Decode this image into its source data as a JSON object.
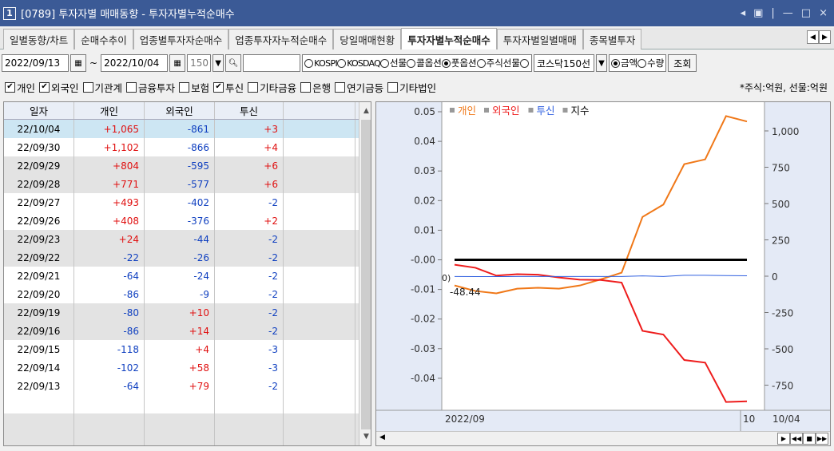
{
  "window": {
    "number": "1",
    "title": "[0789] 투자자별 매매동향 - 투자자별누적순매수",
    "controls": [
      "◂",
      "▣",
      "|",
      "—",
      "□",
      "×"
    ]
  },
  "tabs": [
    {
      "label": "일별동향/차트",
      "active": false
    },
    {
      "label": "순매수추이",
      "active": false
    },
    {
      "label": "업종별투자자순매수",
      "active": false
    },
    {
      "label": "업종투자자누적순매수",
      "active": false
    },
    {
      "label": "당일매매현황",
      "active": false
    },
    {
      "label": "투자자별누적순매수",
      "active": true
    },
    {
      "label": "투자자별일별매매",
      "active": false
    },
    {
      "label": "종목별투자",
      "active": false
    }
  ],
  "toolbar": {
    "start_date": "2022/09/13",
    "sep": "~",
    "end_date": "2022/10/04",
    "count": "150",
    "markets": [
      "KOSPI",
      "KOSDAQ",
      "선물",
      "콜옵션",
      "풋옵션",
      "주식선물",
      "코스닥150선"
    ],
    "selected_market": "풋옵션",
    "units": [
      "금액",
      "수량"
    ],
    "selected_unit": "금액",
    "query_label": "조회"
  },
  "checks": [
    {
      "label": "개인",
      "checked": true
    },
    {
      "label": "외국인",
      "checked": true
    },
    {
      "label": "기관계",
      "checked": false
    },
    {
      "label": "금융투자",
      "checked": false
    },
    {
      "label": "보험",
      "checked": false
    },
    {
      "label": "투신",
      "checked": true
    },
    {
      "label": "기타금융",
      "checked": false
    },
    {
      "label": "은행",
      "checked": false
    },
    {
      "label": "연기금등",
      "checked": false
    },
    {
      "label": "기타법인",
      "checked": false
    }
  ],
  "unit_note": "*주식:억원, 선물:억원",
  "grid": {
    "headers": [
      "일자",
      "개인",
      "외국인",
      "투신"
    ],
    "rows": [
      [
        "22/10/04",
        "+1,065",
        "-861",
        "+3"
      ],
      [
        "22/09/30",
        "+1,102",
        "-866",
        "+4"
      ],
      [
        "22/09/29",
        "+804",
        "-595",
        "+6"
      ],
      [
        "22/09/28",
        "+771",
        "-577",
        "+6"
      ],
      [
        "22/09/27",
        "+493",
        "-402",
        "-2"
      ],
      [
        "22/09/26",
        "+408",
        "-376",
        "+2"
      ],
      [
        "22/09/23",
        "+24",
        "-44",
        "-2"
      ],
      [
        "22/09/22",
        "-22",
        "-26",
        "-2"
      ],
      [
        "22/09/21",
        "-64",
        "-24",
        "-2"
      ],
      [
        "22/09/20",
        "-86",
        "-9",
        "-2"
      ],
      [
        "22/09/19",
        "-80",
        "+10",
        "-2"
      ],
      [
        "22/09/16",
        "-86",
        "+14",
        "-2"
      ],
      [
        "22/09/15",
        "-118",
        "+4",
        "-3"
      ],
      [
        "22/09/14",
        "-102",
        "+58",
        "-3"
      ],
      [
        "22/09/13",
        "-64",
        "+79",
        "-2"
      ]
    ]
  },
  "chart_data": {
    "type": "line",
    "legend": [
      {
        "name": "개인",
        "color": "#f07818"
      },
      {
        "name": "외국인",
        "color": "#ee1c1c"
      },
      {
        "name": "투신",
        "color": "#3060e0"
      },
      {
        "name": "지수",
        "color": "#000000"
      }
    ],
    "x": [
      "22/09/13",
      "22/09/14",
      "22/09/15",
      "22/09/16",
      "22/09/19",
      "22/09/20",
      "22/09/21",
      "22/09/22",
      "22/09/23",
      "22/09/26",
      "22/09/27",
      "22/09/28",
      "22/09/29",
      "22/09/30",
      "22/10/04"
    ],
    "series": [
      {
        "name": "개인",
        "axis": "right",
        "values": [
          -64,
          -102,
          -118,
          -86,
          -80,
          -86,
          -64,
          -22,
          24,
          408,
          493,
          771,
          804,
          1102,
          1065
        ]
      },
      {
        "name": "외국인",
        "axis": "right",
        "values": [
          79,
          58,
          4,
          14,
          10,
          -9,
          -24,
          -26,
          -44,
          -376,
          -402,
          -577,
          -595,
          -866,
          -861
        ]
      },
      {
        "name": "투신",
        "axis": "right",
        "values": [
          -2,
          -3,
          -3,
          -2,
          -2,
          -2,
          -2,
          -2,
          -2,
          2,
          -2,
          6,
          6,
          4,
          3
        ]
      },
      {
        "name": "지수",
        "axis": "left",
        "values": [
          0,
          0,
          0,
          0,
          0,
          0,
          0,
          0,
          0,
          0,
          0,
          0,
          0,
          0,
          0
        ]
      }
    ],
    "left_ticks": [
      "0.05",
      "0.04",
      "0.03",
      "0.02",
      "0.01",
      "-0.00",
      "-0.01",
      "-0.02",
      "-0.03",
      "-0.04"
    ],
    "left_ylim": [
      -0.05,
      0.05
    ],
    "right_ticks": [
      "1,000",
      "750",
      "500",
      "250",
      "0",
      "-250",
      "-500",
      "-750"
    ],
    "right_ylim": [
      -1000,
      1250
    ],
    "x_labels": {
      "left": "2022/09",
      "mid": "10",
      "right": "10/04"
    },
    "annotation": "-48.44",
    "annotation_side": "0)"
  }
}
